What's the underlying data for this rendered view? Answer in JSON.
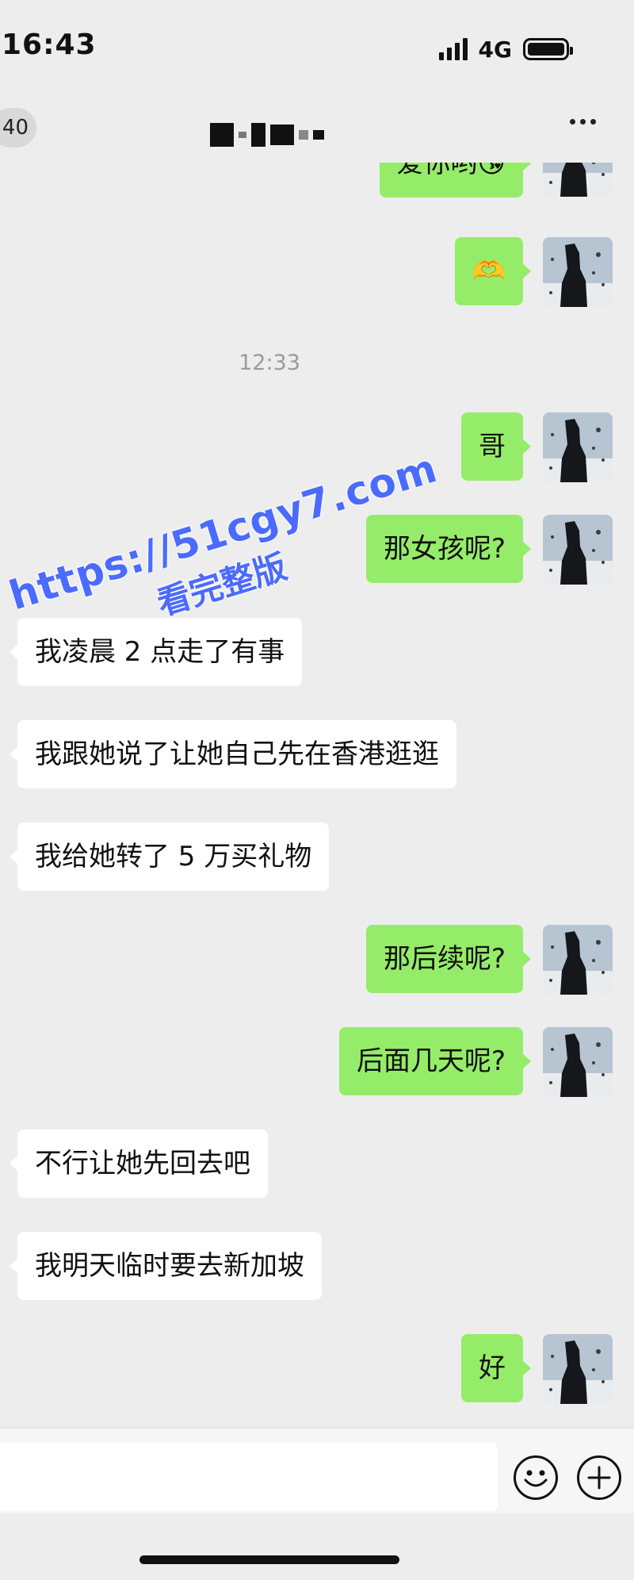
{
  "status_bar": {
    "time": "16:43",
    "network": "4G"
  },
  "nav_bar": {
    "unread_count": "40",
    "title_censored": true
  },
  "messages": [
    {
      "side": "right",
      "text": "爱你哟😘"
    },
    {
      "side": "right",
      "text": "🫶"
    },
    {
      "type": "time",
      "text": "12:33"
    },
    {
      "side": "right",
      "text": "哥"
    },
    {
      "side": "right",
      "text": "那女孩呢?"
    },
    {
      "side": "left",
      "text": "我凌晨 2 点走了有事"
    },
    {
      "side": "left",
      "text": "我跟她说了让她自己先在香港逛逛"
    },
    {
      "side": "left",
      "text": "我给她转了 5 万买礼物"
    },
    {
      "side": "right",
      "text": "那后续呢?"
    },
    {
      "side": "right",
      "text": "后面几天呢?"
    },
    {
      "side": "left",
      "text": "不行让她先回去吧"
    },
    {
      "side": "left",
      "text": "我明天临时要去新加坡"
    },
    {
      "side": "right",
      "text": "好"
    }
  ],
  "watermark": {
    "url": "https://51cgy7.com",
    "text": "看完整版"
  },
  "input_bar": {
    "emoji_icon": "smiley-icon",
    "plus_icon": "plus-circle-icon"
  },
  "colors": {
    "background": "#ededed",
    "outgoing_bubble": "#95ec69",
    "incoming_bubble": "#ffffff",
    "watermark": "#4b6bff"
  }
}
